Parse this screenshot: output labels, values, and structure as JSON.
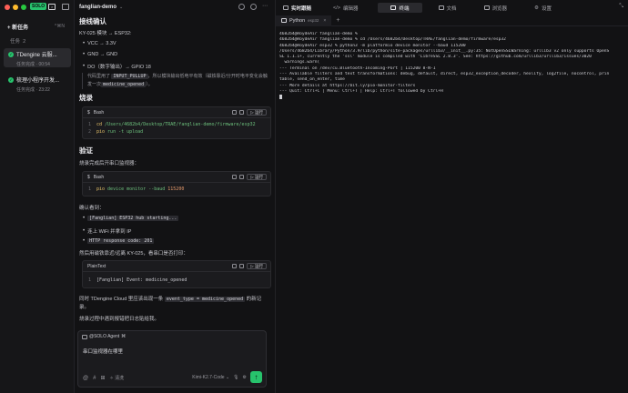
{
  "sidebar": {
    "logo": "SOLO",
    "new_task_label": "+ 新任务",
    "new_task_shortcut": "^⌘N",
    "task_count_label": "任务",
    "task_count": "2",
    "tasks": [
      {
        "title": "TDengine 云服...",
        "subtitle": "任务完成 · 00:54"
      },
      {
        "title": "梳理小程序开发...",
        "subtitle": "任务完成 · 23:22"
      }
    ]
  },
  "chat": {
    "project": "fanglian-demo",
    "section1_title": "接线确认",
    "mapping_line": "KY-025 模块 → ESP32:",
    "bullets1": [
      "VCC → 3.3V",
      "GND → GND",
      "DO（数字输出）→ GPIO 18"
    ],
    "quote_pre": "代码里用了",
    "quote_code": "INPUT_PULLUP",
    "quote_mid": "，所以模块输出低电平有效（磁铁靠近/分开时电平变化会触发一次",
    "quote_code2": "medicine_opened",
    "quote_post": "）。",
    "section2_title": "烧录",
    "code1_lang": "Bash",
    "run_label": "运行",
    "code1_lines": [
      {
        "n": "1",
        "cmd": "cd",
        "arg": "/Users/4682b4/Desktop/TRAE/fanglian-demo/firmware/esp32"
      },
      {
        "n": "2",
        "cmd": "pio",
        "arg": "run -t upload"
      }
    ],
    "section3_title": "验证",
    "verify_intro": "烧录完成后开串口监视器：",
    "code2_lang": "Bash",
    "code2_line": {
      "n": "1",
      "cmd": "pio",
      "arg": "device monitor --baud",
      "num": "115200"
    },
    "should_see": "确认看到：",
    "bullets2": [
      "[Fanglian] ESP32 hub starting...",
      "连上 WiFi 并拿到 IP",
      "HTTP response code: 201"
    ],
    "trigger_text": "然后用磁铁靠近/远离 KY-025，看串口是否打印：",
    "code3_lang": "PlainText",
    "code3_line": {
      "n": "1",
      "text": "[Fanglian] Event: medicine_opened"
    },
    "sync_pre": "同时 TDengine Cloud 里应该出现一条",
    "sync_code": "event_type = medicine_opened",
    "sync_post": "的新记",
    "sync_tail": "录。",
    "closing": "烧录过程中遇到报错把日志贴给我。",
    "composer_agent": "@SOLO Agent",
    "composer_text": "串口监视器在哪里",
    "composer_tools": [
      "@",
      "#",
      "⊞"
    ],
    "composer_mode": "清洗",
    "model": "Kimi-K2.7-Code"
  },
  "right": {
    "tabs": [
      "实时跟随",
      "编辑器",
      "终端",
      "文档",
      "浏览器",
      "设置"
    ],
    "active_tab": "终端",
    "term_tab_label": "Python",
    "term_tab_sub": "esp32",
    "terminal_lines": [
      "4682b4@RoydeAir fanglian-demo %",
      "4682b4@RoydeAir fanglian-demo % cd /Users/4682b4/Desktop/TRAE/fanglian-demo/firmware/esp32",
      "4682b4@RoydeAir esp32 % python3 -m platformio device monitor --baud 115200",
      "/Users/4682b4/Library/Python/3.9/lib/python/site-packages/urllib3/__init__.py:35: NotOpenSSLWarning: urllib3 v2 only supports OpenS",
      "SL 1.1.1+, currently the 'ssl' module is compiled with 'LibreSSL 2.8.3'. See: https://github.com/urllib3/urllib3/issues/3020",
      "  warnings.warn(",
      "--- Terminal on /dev/cu.Bluetooth-Incoming-Port | 115200 8-N-1",
      "--- Available filters and text transformations: debug, default, direct, esp32_exception_decoder, hexlify, log2file, nocontrol, prin",
      "table, send_on_enter, time",
      "--- More details at https://bit.ly/pio-monitor-filters",
      "--- Quit: Ctrl+C | Menu: Ctrl+T | Help: Ctrl+T followed by Ctrl+H"
    ]
  }
}
